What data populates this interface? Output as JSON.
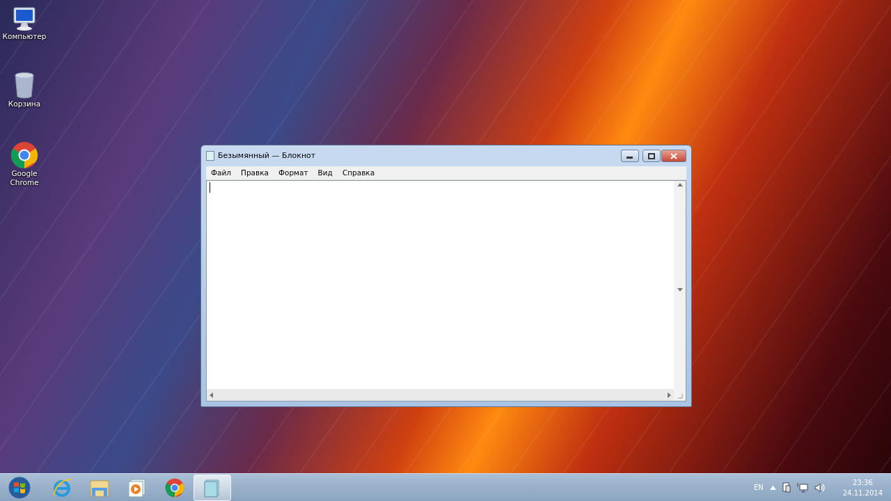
{
  "desktop_icons": [
    {
      "kind": "computer",
      "label": "Компьютер"
    },
    {
      "kind": "recycle",
      "label": "Корзина"
    },
    {
      "kind": "chrome",
      "label": "Google Chrome"
    }
  ],
  "window": {
    "title": "Безымянный — Блокнот",
    "menu": [
      "Файл",
      "Правка",
      "Формат",
      "Вид",
      "Справка"
    ]
  },
  "taskbar": {
    "items": [
      {
        "kind": "start",
        "selected": false
      },
      {
        "kind": "ie",
        "selected": false
      },
      {
        "kind": "explorer",
        "selected": false
      },
      {
        "kind": "media",
        "selected": false
      },
      {
        "kind": "chrome",
        "selected": false
      },
      {
        "kind": "notepad",
        "selected": true
      }
    ],
    "tray": {
      "language": "EN",
      "time": "23:36",
      "date": "24.11.2014"
    }
  }
}
